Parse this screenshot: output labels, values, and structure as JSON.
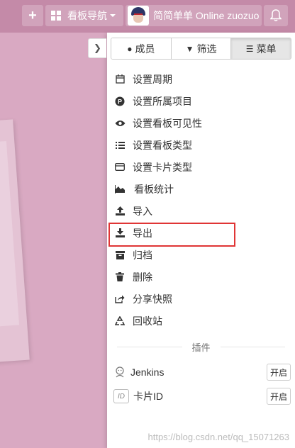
{
  "topbar": {
    "add_label": "+",
    "nav_label": "看板导航",
    "user_label": "简简单单 Online zuozuo"
  },
  "tabs": [
    {
      "label": "成员",
      "icon": "user-icon"
    },
    {
      "label": "筛选",
      "icon": "filter-icon"
    },
    {
      "label": "菜单",
      "icon": "menu-icon"
    }
  ],
  "menu": {
    "items": [
      {
        "label": "设置周期",
        "icon": "calendar-icon"
      },
      {
        "label": "设置所属项目",
        "icon": "project-icon"
      },
      {
        "label": "设置看板可见性",
        "icon": "eye-icon"
      },
      {
        "label": "设置看板类型",
        "icon": "list-icon"
      },
      {
        "label": "设置卡片类型",
        "icon": "card-icon"
      },
      {
        "label": "看板统计",
        "icon": "area-chart-icon"
      },
      {
        "label": "导入",
        "icon": "upload-icon"
      },
      {
        "label": "导出",
        "icon": "download-icon"
      },
      {
        "label": "归档",
        "icon": "archive-icon"
      },
      {
        "label": "删除",
        "icon": "trash-icon"
      },
      {
        "label": "分享快照",
        "icon": "share-icon"
      },
      {
        "label": "回收站",
        "icon": "recycle-icon"
      }
    ]
  },
  "plugins": {
    "section_label": "插件",
    "items": [
      {
        "label": "Jenkins",
        "icon": "jenkins-icon",
        "action": "开启"
      },
      {
        "label": "卡片ID",
        "icon": "id-icon",
        "icon_text": "ID",
        "action": "开启"
      }
    ]
  },
  "watermark": "https://blog.csdn.net/qq_15071263",
  "colors": {
    "background": "#d9a9c2",
    "topbar": "#c48aa8",
    "highlight": "#e03535"
  }
}
